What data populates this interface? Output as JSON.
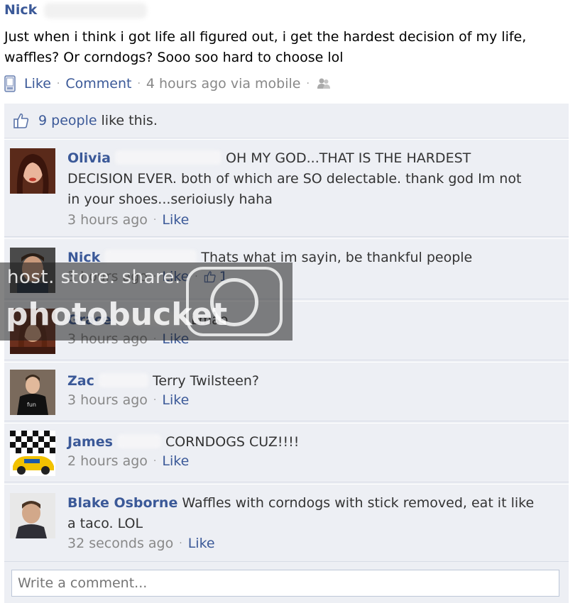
{
  "post": {
    "author": "Nick",
    "text": "Just when i think i got life all figured out, i get the hardest decision of my life, waffles? Or corndogs? Sooo soo hard to choose lol",
    "like_label": "Like",
    "comment_label": "Comment",
    "time": "4 hours ago via mobile",
    "separator": "·"
  },
  "likes": {
    "count_text": "9 people",
    "suffix": "like this."
  },
  "comments": [
    {
      "name": "Olivia",
      "text": "OH MY GOD...THAT IS THE HARDEST DECISION EVER. both of which are SO delectable. thank god Im not in your shoes...serioiusly haha",
      "time": "3 hours ago",
      "like_label": "Like"
    },
    {
      "name": "Nick",
      "text": "Thats what im sayin, be thankful people",
      "time": "3 hours ago",
      "like_label": "Like",
      "like_count": "1"
    },
    {
      "name": "Grace",
      "text": "Lmao",
      "time": "3 hours ago",
      "like_label": "Like"
    },
    {
      "name": "Zac",
      "text": "Terry Twilsteen?",
      "time": "3 hours ago",
      "like_label": "Like"
    },
    {
      "name": "James",
      "text": "CORNDOGS CUZ!!!!",
      "time": "2 hours ago",
      "like_label": "Like"
    },
    {
      "name": "Blake Osborne",
      "text": "Waffles with corndogs with stick removed, eat it like a taco. LOL",
      "time": "32 seconds ago",
      "like_label": "Like"
    }
  ],
  "write_comment": {
    "placeholder": "Write a comment..."
  },
  "watermark": {
    "line1": "host. store. share.",
    "line2": "photobucket"
  },
  "colors": {
    "link": "#3b5998",
    "box_bg": "#edeff4",
    "meta": "#888888"
  }
}
